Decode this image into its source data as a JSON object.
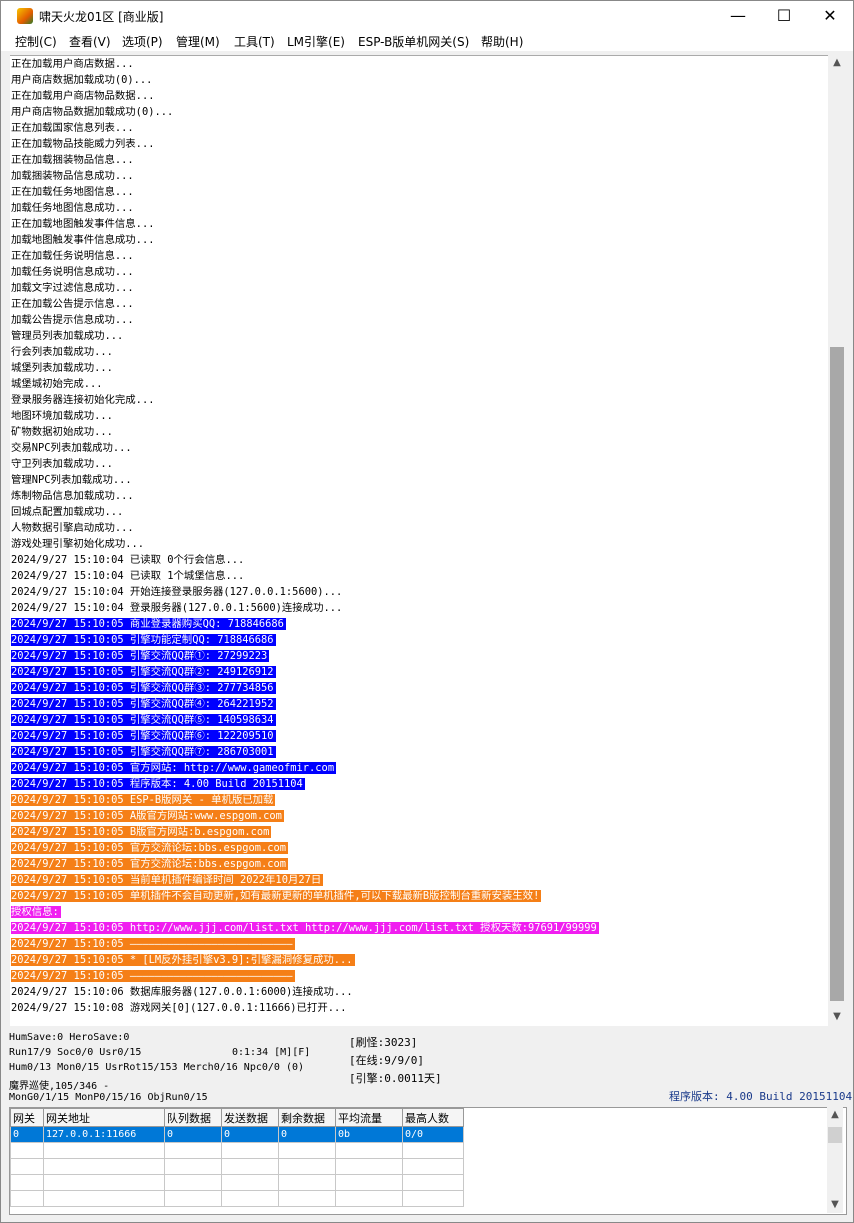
{
  "window": {
    "title": "啸天火龙01区 [商业版]",
    "controls": {
      "minimize": "—",
      "maximize": "☐",
      "close": "✕"
    }
  },
  "menu": [
    "控制(C)",
    "查看(V)",
    "选项(P)",
    "管理(M)",
    "工具(T)",
    "LM引擎(E)",
    "ESP-B版单机网关(S)",
    "帮助(H)"
  ],
  "log": [
    {
      "text": "正在加载用户商店数据...",
      "style": "plain"
    },
    {
      "text": "用户商店数据加载成功(0)...",
      "style": "plain"
    },
    {
      "text": "正在加载用户商店物品数据...",
      "style": "plain"
    },
    {
      "text": "用户商店物品数据加载成功(0)...",
      "style": "plain"
    },
    {
      "text": "正在加载国家信息列表...",
      "style": "plain"
    },
    {
      "text": "正在加载物品技能威力列表...",
      "style": "plain"
    },
    {
      "text": "正在加载捆装物品信息...",
      "style": "plain"
    },
    {
      "text": "加载捆装物品信息成功...",
      "style": "plain"
    },
    {
      "text": "正在加载任务地图信息...",
      "style": "plain"
    },
    {
      "text": "加载任务地图信息成功...",
      "style": "plain"
    },
    {
      "text": "正在加载地图触发事件信息...",
      "style": "plain"
    },
    {
      "text": "加载地图触发事件信息成功...",
      "style": "plain"
    },
    {
      "text": "正在加载任务说明信息...",
      "style": "plain"
    },
    {
      "text": "加载任务说明信息成功...",
      "style": "plain"
    },
    {
      "text": "加载文字过滤信息成功...",
      "style": "plain"
    },
    {
      "text": "正在加载公告提示信息...",
      "style": "plain"
    },
    {
      "text": "加载公告提示信息成功...",
      "style": "plain"
    },
    {
      "text": "管理员列表加载成功...",
      "style": "plain"
    },
    {
      "text": "行会列表加载成功...",
      "style": "plain"
    },
    {
      "text": "城堡列表加载成功...",
      "style": "plain"
    },
    {
      "text": "城堡城初始完成...",
      "style": "plain"
    },
    {
      "text": "登录服务器连接初始化完成...",
      "style": "plain"
    },
    {
      "text": "地图环境加载成功...",
      "style": "plain"
    },
    {
      "text": "矿物数据初始成功...",
      "style": "plain"
    },
    {
      "text": "交易NPC列表加载成功...",
      "style": "plain"
    },
    {
      "text": "守卫列表加载成功...",
      "style": "plain"
    },
    {
      "text": "管理NPC列表加载成功...",
      "style": "plain"
    },
    {
      "text": "炼制物品信息加载成功...",
      "style": "plain"
    },
    {
      "text": "回城点配置加载成功...",
      "style": "plain"
    },
    {
      "text": "人物数据引擎启动成功...",
      "style": "plain"
    },
    {
      "text": "游戏处理引擎初始化成功...",
      "style": "plain"
    },
    {
      "text": "2024/9/27 15:10:04 已读取 0个行会信息...",
      "style": "plain"
    },
    {
      "text": "2024/9/27 15:10:04 已读取 1个城堡信息...",
      "style": "plain"
    },
    {
      "text": "2024/9/27 15:10:04 开始连接登录服务器(127.0.0.1:5600)...",
      "style": "plain"
    },
    {
      "text": "2024/9/27 15:10:04 登录服务器(127.0.0.1:5600)连接成功...",
      "style": "plain"
    },
    {
      "text": "2024/9/27 15:10:05 商业登录器购买QQ: 718846686",
      "style": "blue"
    },
    {
      "text": "2024/9/27 15:10:05 引擎功能定制QQ: 718846686",
      "style": "blue"
    },
    {
      "text": "2024/9/27 15:10:05 引擎交流QQ群①: 27299223",
      "style": "blue"
    },
    {
      "text": "2024/9/27 15:10:05 引擎交流QQ群②: 249126912",
      "style": "blue"
    },
    {
      "text": "2024/9/27 15:10:05 引擎交流QQ群③: 277734856",
      "style": "blue"
    },
    {
      "text": "2024/9/27 15:10:05 引擎交流QQ群④: 264221952",
      "style": "blue"
    },
    {
      "text": "2024/9/27 15:10:05 引擎交流QQ群⑤: 140598634",
      "style": "blue"
    },
    {
      "text": "2024/9/27 15:10:05 引擎交流QQ群⑥: 122209510",
      "style": "blue"
    },
    {
      "text": "2024/9/27 15:10:05 引擎交流QQ群⑦: 286703001",
      "style": "blue"
    },
    {
      "text": "2024/9/27 15:10:05 官方网站: http://www.gameofmir.com",
      "style": "blue"
    },
    {
      "text": "2024/9/27 15:10:05 程序版本: 4.00 Build 20151104",
      "style": "blue"
    },
    {
      "text": "2024/9/27 15:10:05 ESP-B版网关 - 单机版已加载",
      "style": "orange"
    },
    {
      "text": "2024/9/27 15:10:05 A版官方网站:www.espgom.com",
      "style": "orange"
    },
    {
      "text": "2024/9/27 15:10:05 B版官方网站:b.espgom.com",
      "style": "orange"
    },
    {
      "text": "2024/9/27 15:10:05 官方交流论坛:bbs.espgom.com",
      "style": "orange"
    },
    {
      "text": "2024/9/27 15:10:05 官方交流论坛:bbs.espgom.com",
      "style": "orange"
    },
    {
      "text": "2024/9/27 15:10:05 当前单机插件编译时间 2022年10月27日",
      "style": "orange"
    },
    {
      "text": "2024/9/27 15:10:05 单机插件不会自动更新,如有最新更新的单机插件,可以下载最新B版控制台重新安装生效!",
      "style": "orange"
    },
    {
      "text": "授权信息:",
      "style": "magenta"
    },
    {
      "text": "2024/9/27 15:10:05 http://www.jjj.com/list.txt http://www.jjj.com/list.txt 授权天数:97691/99999",
      "style": "magenta"
    },
    {
      "text": "2024/9/27 15:10:05 ——————————————————————————",
      "style": "orange"
    },
    {
      "text": "2024/9/27 15:10:05 * [LM反外挂引擎v3.9]:引擎漏洞修复成功...",
      "style": "orange"
    },
    {
      "text": "2024/9/27 15:10:05 ——————————————————————————",
      "style": "orange"
    },
    {
      "text": "2024/9/27 15:10:06 数据库服务器(127.0.0.1:6000)连接成功...",
      "style": "plain"
    },
    {
      "text": "2024/9/27 15:10:08 游戏网关[0](127.0.0.1:11666)已打开...",
      "style": "plain"
    }
  ],
  "stats": {
    "line1": "HumSave:0 HeroSave:0",
    "line2": "Run17/9 Soc0/0 Usr0/15",
    "runtime": "0:1:34 [M][F]",
    "line3": "Hum0/13 Mon0/15 UsrRot15/153 Merch0/16 Npc0/0 (0)",
    "line4": "魔界巡使,105/346 -",
    "line5": "MonG0/1/15 MonP0/15/16 ObjRun0/15",
    "refresh": "[刷怪:3023]",
    "online": "[在线:9/9/0]",
    "engine": "[引擎:0.0011天]",
    "version": "程序版本: 4.00 Build 20151104"
  },
  "gateway_table": {
    "headers": [
      "网关",
      "网关地址",
      "队列数据",
      "发送数据",
      "剩余数据",
      "平均流量",
      "最高人数"
    ],
    "rows": [
      [
        "0",
        "127.0.0.1:11666",
        "0",
        "0",
        "0",
        "0b",
        "0/0"
      ]
    ]
  },
  "icons": {
    "app": "dragon-app-icon",
    "scroll_up": "▲",
    "scroll_down": "▼"
  }
}
